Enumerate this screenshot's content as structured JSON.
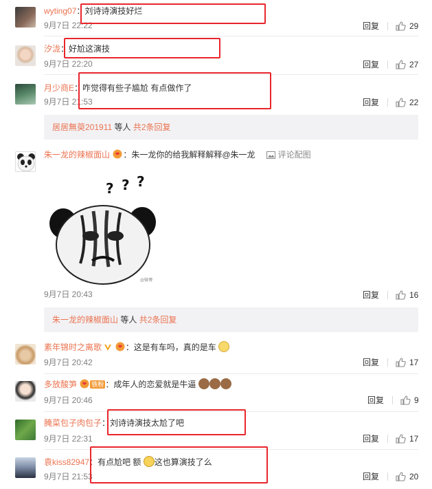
{
  "comments": [
    {
      "user": "wyting07",
      "text": "刘诗诗演技好烂",
      "time": "9月7日 22:22",
      "reply": "回复",
      "likes": "29"
    },
    {
      "user": "汐泷",
      "text": "好尬这演技",
      "time": "9月7日 22:20",
      "reply": "回复",
      "likes": "27"
    },
    {
      "user": "月少商E",
      "text": "咋觉得有些子尴尬 有点做作了",
      "time": "9月7日 21:53",
      "reply": "回复",
      "likes": "22"
    },
    {
      "user": "朱一龙的辣椒面山",
      "text": "朱一龙你的给我解释解释@朱一龙",
      "time": "9月7日 20:43",
      "reply": "回复",
      "likes": "16",
      "action": "评论配图"
    },
    {
      "user": "素年锦时之离歌",
      "text": "这是有车吗，真的是车",
      "time": "9月7日 20:42",
      "reply": "回复",
      "likes": "17"
    },
    {
      "user": "多放酸笋",
      "text": "成年人的恋爱就是牛逼",
      "time": "9月7日 20:46",
      "reply": "回复",
      "likes": "9",
      "badge": "铁粉"
    },
    {
      "user": "腌菜包子肉包子",
      "text": "刘诗诗演技太尬了吧",
      "time": "9月7日 22:31",
      "reply": "回复",
      "likes": "17"
    },
    {
      "user": "袁kiss82947",
      "text": "有点尬吧  额",
      "text2": "这也算演技了么",
      "time": "9月7日 21:53",
      "reply": "回复",
      "likes": "20"
    }
  ],
  "subreplies": [
    {
      "users": "居居無萸201911",
      "mid": " 等人 ",
      "count": "共2条回复"
    },
    {
      "users": "朱一龙的辣椒面山",
      "mid": " 等人 ",
      "count": "共2条回复"
    }
  ],
  "colors": {
    "username": "#eb7350",
    "highlight_box": "#e8252b",
    "subreply_bg": "#f2f2f5"
  },
  "icons": [
    "thumb-up-icon",
    "image-icon",
    "vip-v-icon",
    "fan-badge-icon",
    "panda-avatar",
    "confused-panda-meme"
  ]
}
